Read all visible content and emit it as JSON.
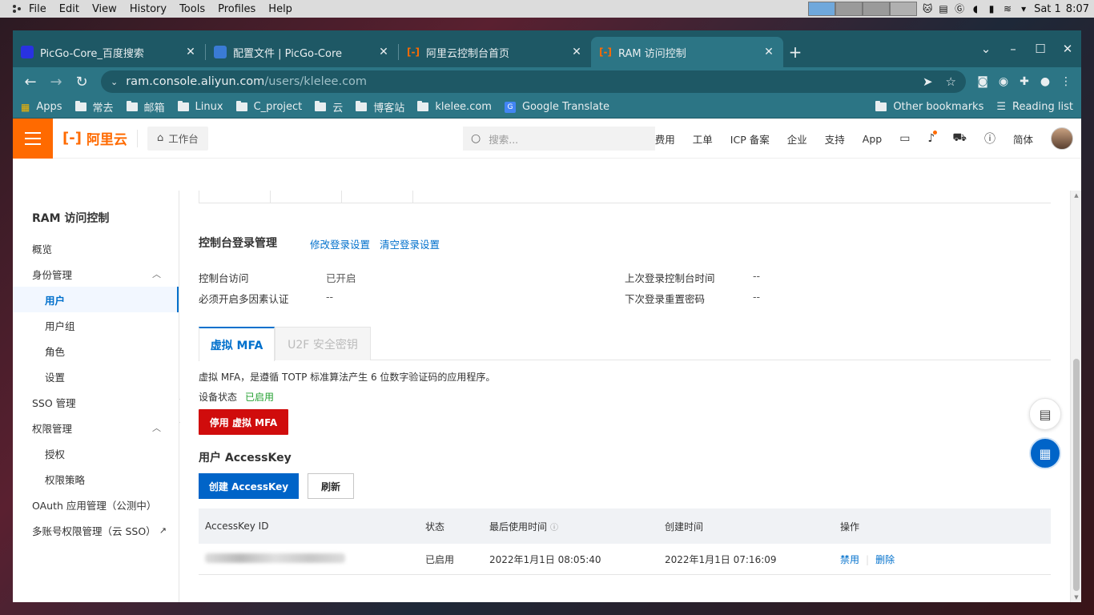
{
  "os": {
    "menu": [
      "File",
      "Edit",
      "View",
      "History",
      "Tools",
      "Profiles",
      "Help"
    ],
    "date": "Sat 1",
    "time": "8:07"
  },
  "browser": {
    "tabs": [
      {
        "title": "PicGo-Core_百度搜索",
        "favicon_color": "#2932e1",
        "active": false
      },
      {
        "title": "配置文件 | PicGo-Core",
        "favicon_color": "#3a7bd5",
        "active": false
      },
      {
        "title": "阿里云控制台首页",
        "favicon_color": "#ff6a00",
        "active": false
      },
      {
        "title": "RAM 访问控制",
        "favicon_color": "#ff6a00",
        "active": true
      }
    ],
    "url_host": "ram.console.aliyun.com",
    "url_path": "/users/klelee.com",
    "bookmarks": [
      {
        "label": "Apps",
        "type": "apps"
      },
      {
        "label": "常去",
        "type": "folder"
      },
      {
        "label": "邮箱",
        "type": "folder"
      },
      {
        "label": "Linux",
        "type": "folder"
      },
      {
        "label": "C_project",
        "type": "folder"
      },
      {
        "label": "云",
        "type": "folder"
      },
      {
        "label": "博客站",
        "type": "folder"
      },
      {
        "label": "klelee.com",
        "type": "folder"
      },
      {
        "label": "Google Translate",
        "type": "link"
      }
    ],
    "other_bookmarks": "Other bookmarks",
    "reading_list": "Reading list"
  },
  "header": {
    "logo": "阿里云",
    "workbench": "工作台",
    "search_placeholder": "搜索...",
    "nav": [
      "费用",
      "工单",
      "ICP 备案",
      "企业",
      "支持",
      "App"
    ],
    "lang": "简体"
  },
  "sidebar": {
    "title": "RAM 访问控制",
    "items": [
      {
        "label": "概览",
        "level": 1
      },
      {
        "label": "身份管理",
        "level": 1,
        "expand": true
      },
      {
        "label": "用户",
        "level": 2,
        "active": true
      },
      {
        "label": "用户组",
        "level": 2
      },
      {
        "label": "角色",
        "level": 2
      },
      {
        "label": "设置",
        "level": 2
      },
      {
        "label": "SSO 管理",
        "level": 1
      },
      {
        "label": "权限管理",
        "level": 1,
        "expand": true
      },
      {
        "label": "授权",
        "level": 2
      },
      {
        "label": "权限策略",
        "level": 2
      },
      {
        "label": "OAuth 应用管理（公测中）",
        "level": 1
      },
      {
        "label": "多账号权限管理（云 SSO）",
        "level": 1,
        "external": true
      }
    ]
  },
  "login": {
    "title": "控制台登录管理",
    "edit_link": "修改登录设置",
    "clear_link": "清空登录设置",
    "console_access_label": "控制台访问",
    "console_access_value": "已开启",
    "mfa_required_label": "必须开启多因素认证",
    "mfa_required_value": "--",
    "last_login_label": "上次登录控制台时间",
    "last_login_value": "--",
    "next_reset_label": "下次登录重置密码",
    "next_reset_value": "--"
  },
  "mfa": {
    "tab_virtual": "虚拟 MFA",
    "tab_u2f": "U2F 安全密钥",
    "description": "虚拟 MFA，是遵循 TOTP 标准算法产生 6 位数字验证码的应用程序。",
    "status_label": "设备状态",
    "status_value": "已启用",
    "disable_button": "停用 虚拟 MFA"
  },
  "accesskey": {
    "title": "用户 AccessKey",
    "create_button": "创建 AccessKey",
    "refresh_button": "刷新",
    "columns": [
      "AccessKey ID",
      "状态",
      "最后使用时间",
      "创建时间",
      "操作"
    ],
    "rows": [
      {
        "status": "已启用",
        "last_used": "2022年1月1日 08:05:40",
        "created": "2022年1月1日 07:16:09",
        "action_disable": "禁用",
        "action_delete": "删除"
      }
    ]
  }
}
